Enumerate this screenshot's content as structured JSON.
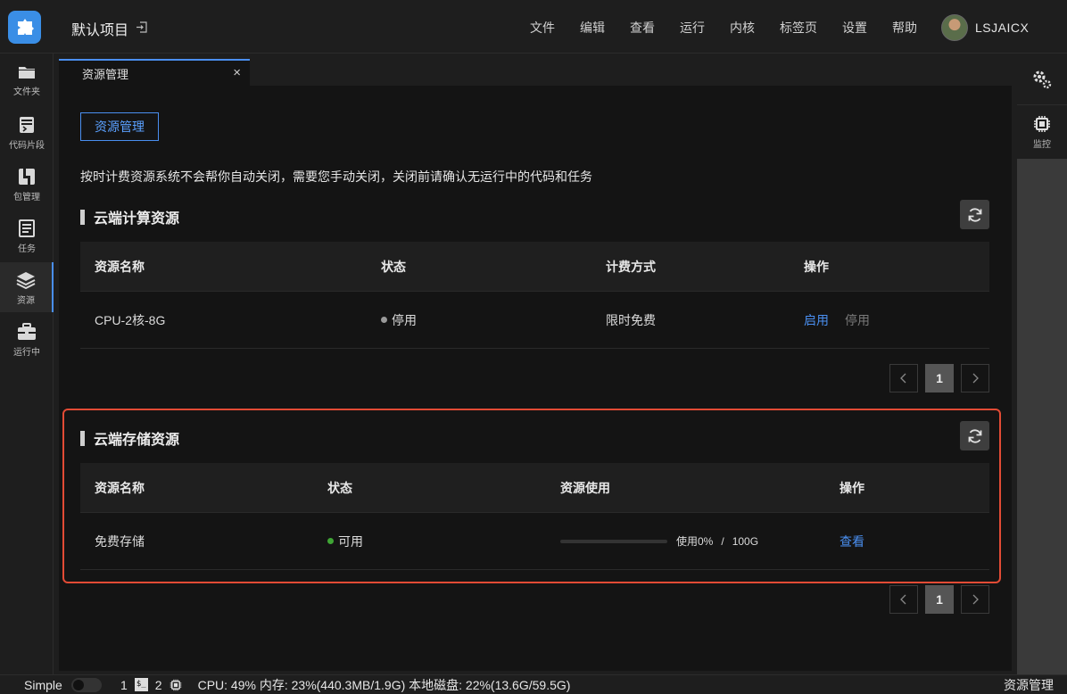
{
  "header": {
    "project_title": "默认项目",
    "menu": [
      "文件",
      "编辑",
      "查看",
      "运行",
      "内核",
      "标签页",
      "设置",
      "帮助"
    ],
    "username": "LSJAICX"
  },
  "sidebar": {
    "items": [
      {
        "label": "文件夹",
        "icon": "folder-icon"
      },
      {
        "label": "代码片段",
        "icon": "snippet-icon"
      },
      {
        "label": "包管理",
        "icon": "package-icon"
      },
      {
        "label": "任务",
        "icon": "task-icon"
      },
      {
        "label": "资源",
        "icon": "layers-icon",
        "active": true
      },
      {
        "label": "运行中",
        "icon": "briefcase-icon"
      }
    ]
  },
  "right_panel": {
    "monitor_label": "监控"
  },
  "tab": {
    "label": "资源管理",
    "close": "×"
  },
  "main": {
    "resource_button": "资源管理",
    "notice": "按时计费资源系统不会帮你自动关闭，需要您手动关闭，关闭前请确认无运行中的代码和任务",
    "compute": {
      "title": "云端计算资源",
      "headers": [
        "资源名称",
        "状态",
        "计费方式",
        "操作"
      ],
      "row": {
        "name": "CPU-2核-8G",
        "status": "停用",
        "billing": "限时免费",
        "action_enable": "启用",
        "action_disable": "停用"
      },
      "page": "1"
    },
    "storage": {
      "title": "云端存储资源",
      "headers": [
        "资源名称",
        "状态",
        "资源使用",
        "操作"
      ],
      "row": {
        "name": "免费存储",
        "status": "可用",
        "usage_text": "使用0%",
        "separator": "/",
        "capacity": "100G",
        "usage_fraction": 0,
        "action_view": "查看"
      },
      "page": "1"
    }
  },
  "statusbar": {
    "mode": "Simple",
    "count1": "1",
    "terminal_glyph": "$_",
    "count2": "2",
    "stats": "CPU:  49% 内存:  23%(440.3MB/1.9G) 本地磁盘:  22%(13.6G/59.5G)",
    "right_label": "资源管理"
  },
  "colors": {
    "accent": "#4a8ff0",
    "status_stopped": "#9a9a9a",
    "status_available": "#3fa535",
    "highlight": "#e24b35"
  }
}
